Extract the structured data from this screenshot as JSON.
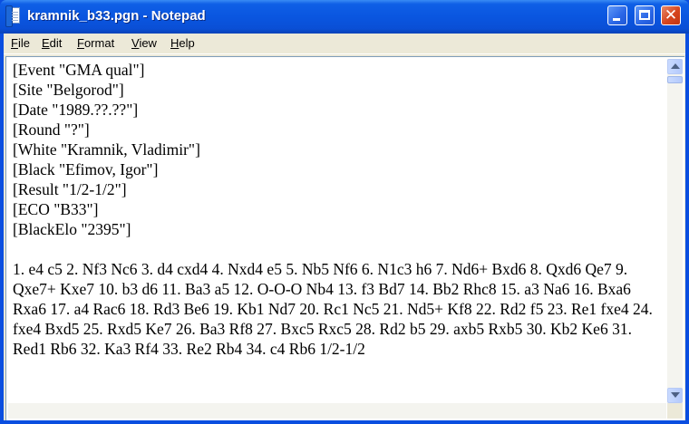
{
  "window": {
    "title": "kramnik_b33.pgn - Notepad",
    "icon": "notepad-icon",
    "controls": {
      "minimize": "minimize-icon",
      "maximize": "maximize-icon",
      "close": "close-icon"
    }
  },
  "menu": {
    "items": [
      {
        "label": "File",
        "mnemonic": "F",
        "rest": "ile"
      },
      {
        "label": "Edit",
        "mnemonic": "E",
        "rest": "dit"
      },
      {
        "label": "Format",
        "mnemonic": "F",
        "rest": "ormat"
      },
      {
        "label": "View",
        "mnemonic": "V",
        "rest": "iew"
      },
      {
        "label": "Help",
        "mnemonic": "H",
        "rest": "elp"
      }
    ]
  },
  "document": {
    "text": "[Event \"GMA qual\"]\n[Site \"Belgorod\"]\n[Date \"1989.??.??\"]\n[Round \"?\"]\n[White \"Kramnik, Vladimir\"]\n[Black \"Efimov, Igor\"]\n[Result \"1/2-1/2\"]\n[ECO \"B33\"]\n[BlackElo \"2395\"]\n\n1. e4 c5 2. Nf3 Nc6 3. d4 cxd4 4. Nxd4 e5 5. Nb5 Nf6 6. N1c3 h6 7. Nd6+ Bxd6 8. Qxd6 Qe7 9. Qxe7+ Kxe7 10. b3 d6 11. Ba3 a5 12. O-O-O Nb4 13. f3 Bd7 14. Bb2 Rhc8 15. a3 Na6 16. Bxa6 Rxa6 17. a4 Rac6 18. Rd3 Be6 19. Kb1 Nd7 20. Rc1 Nc5 21. Nd5+ Kf8 22. Rd2 f5 23. Re1 fxe4 24. fxe4 Bxd5 25. Rxd5 Ke7 26. Ba3 Rf8 27. Bxc5 Rxc5 28. Rd2 b5 29. axb5 Rxb5 30. Kb2 Ke6 31. Red1 Rb6 32. Ka3 Rf4 33. Re2 Rb4 34. c4 Rb6 1/2-1/2"
  },
  "colors": {
    "titlebar": "#0a56e0",
    "frame": "#ece9d8",
    "close": "#d6451e"
  }
}
